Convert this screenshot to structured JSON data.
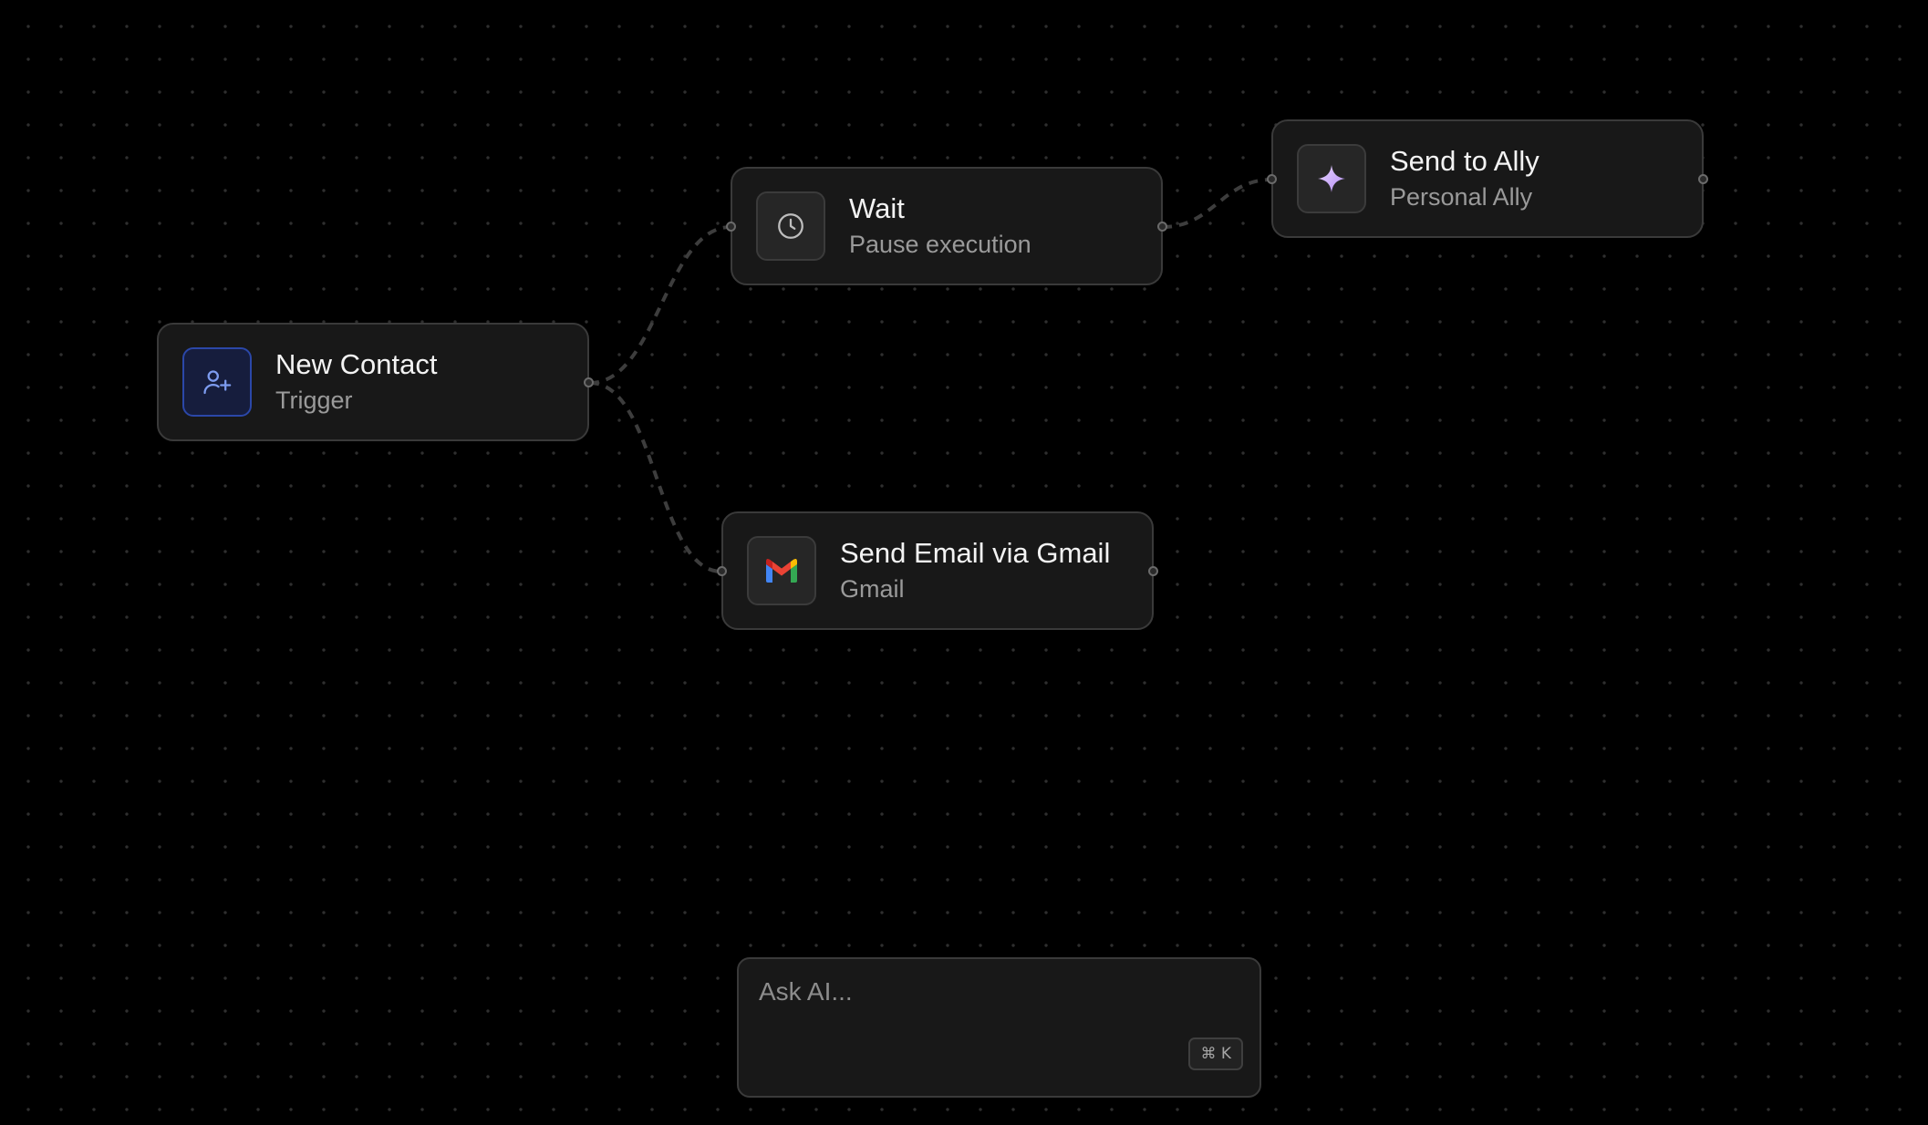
{
  "nodes": [
    {
      "id": "new-contact",
      "title": "New Contact",
      "subtitle": "Trigger",
      "icon": "user-plus-icon"
    },
    {
      "id": "wait",
      "title": "Wait",
      "subtitle": "Pause execution",
      "icon": "clock-icon"
    },
    {
      "id": "send-to-ally",
      "title": "Send to Ally",
      "subtitle": "Personal Ally",
      "icon": "sparkle-icon"
    },
    {
      "id": "send-email-gmail",
      "title": "Send Email via Gmail",
      "subtitle": "Gmail",
      "icon": "gmail-icon"
    }
  ],
  "ask_ai": {
    "placeholder": "Ask AI...",
    "shortcut": "⌘ K"
  },
  "colors": {
    "canvas": "#000000",
    "node_bg": "#181818",
    "node_border": "#3a3a3a",
    "trigger_accent": "#2b47a8",
    "edge": "#3d3d3d"
  }
}
